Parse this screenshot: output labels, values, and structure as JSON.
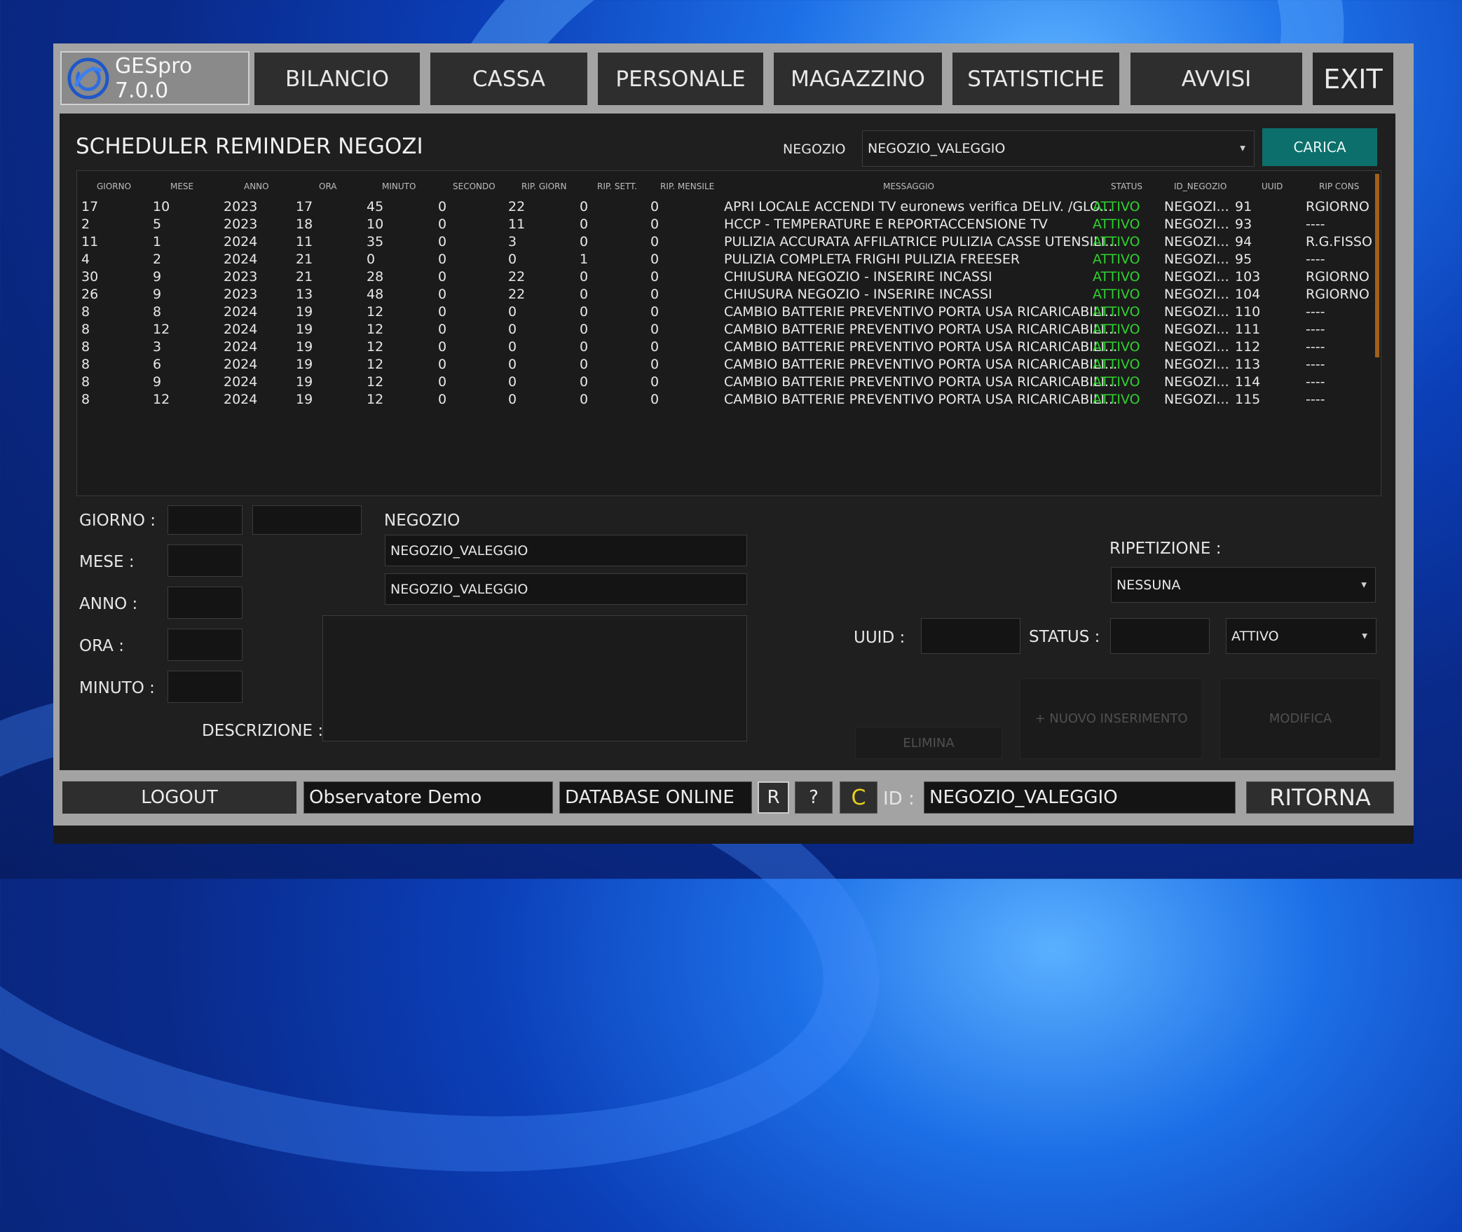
{
  "app": {
    "logo_text": "GESpro 7.0.0"
  },
  "tabs": [
    "BILANCIO",
    "CASSA",
    "PERSONALE",
    "MAGAZZINO",
    "STATISTICHE",
    "AVVISI"
  ],
  "exit_label": "EXIT",
  "page_title": "SCHEDULER REMINDER NEGOZI",
  "filter": {
    "label": "NEGOZIO",
    "value": "NEGOZIO_VALEGGIO",
    "load_button": "CARICA"
  },
  "table": {
    "headers": [
      "GIORNO",
      "MESE",
      "ANNO",
      "ORA",
      "MINUTO",
      "SECONDO",
      "RIP. GIORN",
      "RIP. SETT.",
      "RIP. MENSILE",
      "MESSAGGIO",
      "STATUS",
      "ID_NEGOZIO",
      "UUID",
      "RIP CONS"
    ],
    "rows": [
      [
        "17",
        "10",
        "2023",
        "17",
        "45",
        "0",
        "22",
        "0",
        "0",
        "APRI LOCALE ACCENDI TV euronews verifica DELIV.  /GLO...",
        "ATTIVO",
        "NEGOZI...",
        "91",
        "RGIORNO"
      ],
      [
        "2",
        "5",
        "2023",
        "18",
        "10",
        "0",
        "11",
        "0",
        "0",
        "HCCP -  TEMPERATURE E REPORTACCENSIONE TV",
        "ATTIVO",
        "NEGOZI...",
        "93",
        "----"
      ],
      [
        "11",
        "1",
        "2024",
        "11",
        "35",
        "0",
        "3",
        "0",
        "0",
        "PULIZIA ACCURATA AFFILATRICE PULIZIA CASSE UTENSILI...",
        "ATTIVO",
        "NEGOZI...",
        "94",
        "R.G.FISSO"
      ],
      [
        "4",
        "2",
        "2024",
        "21",
        "0",
        "0",
        "0",
        "1",
        "0",
        "PULIZIA COMPLETA FRIGHI PULIZIA FREESER",
        "ATTIVO",
        "NEGOZI...",
        "95",
        "----"
      ],
      [
        "30",
        "9",
        "2023",
        "21",
        "28",
        "0",
        "22",
        "0",
        "0",
        "CHIUSURA NEGOZIO - INSERIRE INCASSI",
        "ATTIVO",
        "NEGOZI...",
        "103",
        "RGIORNO"
      ],
      [
        "26",
        "9",
        "2023",
        "13",
        "48",
        "0",
        "22",
        "0",
        "0",
        "CHIUSURA NEGOZIO - INSERIRE INCASSI",
        "ATTIVO",
        "NEGOZI...",
        "104",
        "RGIORNO"
      ],
      [
        "8",
        "8",
        "2024",
        "19",
        "12",
        "0",
        "0",
        "0",
        "0",
        "CAMBIO BATTERIE PREVENTIVO PORTA USA RICARICABILI...",
        "ATTIVO",
        "NEGOZI...",
        "110",
        "----"
      ],
      [
        "8",
        "12",
        "2024",
        "19",
        "12",
        "0",
        "0",
        "0",
        "0",
        "CAMBIO BATTERIE PREVENTIVO PORTA USA RICARICABILI...",
        "ATTIVO",
        "NEGOZI...",
        "111",
        "----"
      ],
      [
        "8",
        "3",
        "2024",
        "19",
        "12",
        "0",
        "0",
        "0",
        "0",
        "CAMBIO BATTERIE PREVENTIVO PORTA USA RICARICABILI...",
        "ATTIVO",
        "NEGOZI...",
        "112",
        "----"
      ],
      [
        "8",
        "6",
        "2024",
        "19",
        "12",
        "0",
        "0",
        "0",
        "0",
        "CAMBIO BATTERIE PREVENTIVO PORTA USA RICARICABILI...",
        "ATTIVO",
        "NEGOZI...",
        "113",
        "----"
      ],
      [
        "8",
        "9",
        "2024",
        "19",
        "12",
        "0",
        "0",
        "0",
        "0",
        "CAMBIO BATTERIE PREVENTIVO PORTA USA RICARICABILI...",
        "ATTIVO",
        "NEGOZI...",
        "114",
        "----"
      ],
      [
        "8",
        "12",
        "2024",
        "19",
        "12",
        "0",
        "0",
        "0",
        "0",
        "CAMBIO BATTERIE PREVENTIVO PORTA USA RICARICABILI...",
        "ATTIVO",
        "NEGOZI...",
        "115",
        "----"
      ]
    ]
  },
  "form": {
    "giorno_label": "GIORNO :",
    "mese_label": "MESE :",
    "anno_label": "ANNO :",
    "ora_label": "ORA :",
    "minuto_label": "MINUTO :",
    "descrizione_label": "DESCRIZIONE :",
    "negozio_label": "NEGOZIO",
    "negozio_value_1": "NEGOZIO_VALEGGIO",
    "negozio_value_2": "NEGOZIO_VALEGGIO",
    "ripetizione_label": "RIPETIZIONE :",
    "ripetizione_value": "NESSUNA",
    "uuid_label": "UUID :",
    "status_label": "STATUS :",
    "status_value": "ATTIVO",
    "elimina": "ELIMINA",
    "nuovo": "+ NUOVO INSERIMENTO",
    "modifica": "MODIFICA"
  },
  "statusbar": {
    "logout": "LOGOUT",
    "user": "Observatore  Demo",
    "db": "DATABASE ONLINE",
    "r": "R",
    "help": "?",
    "c": "C",
    "id_label": "ID :",
    "id_value": "NEGOZIO_VALEGGIO",
    "back": "RITORNA"
  },
  "colors": {
    "accent_teal": "#0c6f6b",
    "status_green": "#2fd12f",
    "c_yellow": "#e8d21a"
  }
}
